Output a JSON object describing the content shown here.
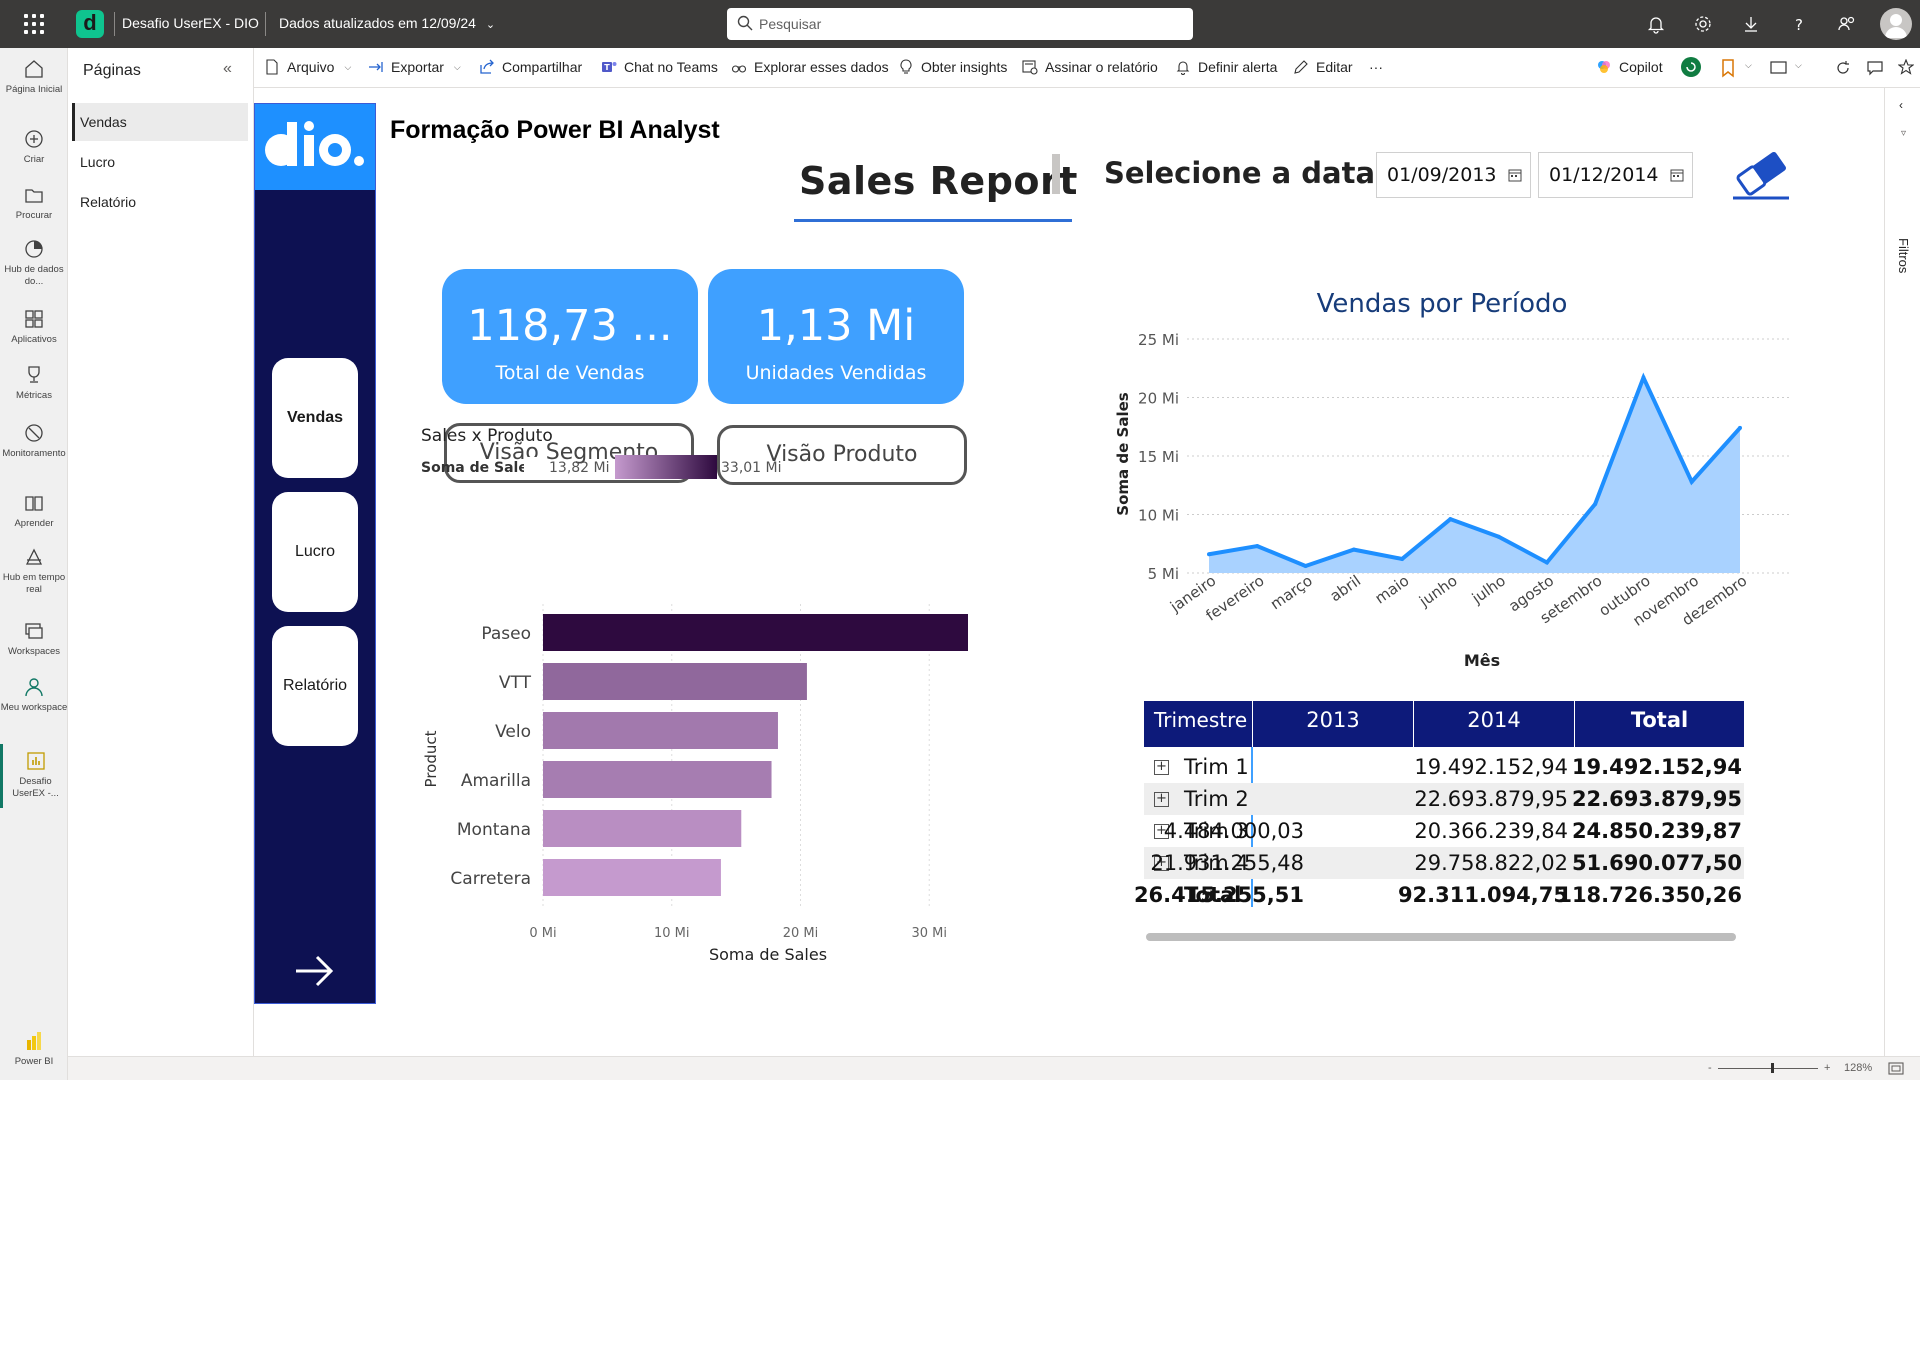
{
  "topbar": {
    "app_title": "Desafio UserEX - DIO",
    "updated": "Dados atualizados em 12/09/24",
    "search_placeholder": "Pesquisar"
  },
  "rail": {
    "items": [
      {
        "label": "Página Inicial",
        "icon": "home-icon"
      },
      {
        "label": "Criar",
        "icon": "plus-circle-icon"
      },
      {
        "label": "Procurar",
        "icon": "folder-icon"
      },
      {
        "label": "Hub de dados do...",
        "icon": "data-hub-icon"
      },
      {
        "label": "Aplicativos",
        "icon": "apps-icon"
      },
      {
        "label": "Métricas",
        "icon": "trophy-icon"
      },
      {
        "label": "Monitoramento",
        "icon": "monitor-icon"
      },
      {
        "label": "Aprender",
        "icon": "book-icon"
      },
      {
        "label": "Hub em tempo real",
        "icon": "realtime-hub-icon"
      },
      {
        "label": "Workspaces",
        "icon": "workspaces-icon"
      },
      {
        "label": "Meu workspace",
        "icon": "person-icon"
      },
      {
        "label": "Desafio UserEX -...",
        "icon": "report-icon"
      }
    ],
    "footer_label": "Power BI"
  },
  "pages": {
    "title": "Páginas",
    "items": [
      "Vendas",
      "Lucro",
      "Relatório"
    ],
    "active": "Vendas"
  },
  "toolbar": {
    "file": "Arquivo",
    "export": "Exportar",
    "share": "Compartilhar",
    "teams": "Chat no Teams",
    "explore": "Explorar esses dados",
    "insights": "Obter insights",
    "subscribe": "Assinar o relatório",
    "alert": "Definir alerta",
    "edit": "Editar",
    "more": "···",
    "copilot": "Copilot"
  },
  "filters_label": "Filtros",
  "status": {
    "zoom": "128%",
    "minus": "-",
    "plus": "+"
  },
  "report": {
    "title": "Formação Power BI Analyst",
    "heading": "Sales Report",
    "select_date_label": "Selecione a data",
    "date_start": "01/09/2013",
    "date_end": "01/12/2014",
    "nav_buttons": [
      "Vendas",
      "Lucro",
      "Relatório"
    ],
    "kpis": [
      {
        "value": "118,73 ...",
        "label": "Total de Vendas"
      },
      {
        "value": "1,13 Mi",
        "label": "Unidades Vendidas"
      }
    ],
    "view_buttons": [
      "Visão Segmento",
      "Visão Produto"
    ]
  },
  "colors": {
    "navy": "#0d1152",
    "kpi_blue": "#3fa0ff",
    "matrix_header": "#0d1a7a",
    "line_blue": "#1e8fff",
    "area_fill": "#a9d2ff",
    "bar_dark": "#2e0a3f",
    "bar_light": "#c59ace"
  },
  "chart_data": [
    {
      "type": "bar",
      "orientation": "horizontal",
      "title": "Sales x Produto",
      "legend_title": "Soma de  Sales",
      "legend_min": "13,82 Mi",
      "legend_max": "33,01 Mi",
      "ylabel": "Product",
      "xlabel": "Soma de Sales",
      "categories": [
        "Paseo",
        "VTT",
        "Velo",
        "Amarilla",
        "Montana",
        "Carretera"
      ],
      "values": [
        33.01,
        20.5,
        18.25,
        17.75,
        15.4,
        13.82
      ],
      "unit": "Mi",
      "xlim": [
        0,
        33.01
      ],
      "xticks": [
        "0 Mi",
        "10 Mi",
        "20 Mi",
        "30 Mi"
      ],
      "grid": true
    },
    {
      "type": "area",
      "title": "Vendas por Período",
      "xlabel": "Mês",
      "ylabel": "Soma de Sales",
      "categories": [
        "janeiro",
        "fevereiro",
        "março",
        "abril",
        "maio",
        "junho",
        "julho",
        "agosto",
        "setembro",
        "outubro",
        "novembro",
        "dezembro"
      ],
      "values": [
        6.6,
        7.3,
        5.6,
        7.0,
        6.2,
        9.6,
        8.1,
        5.9,
        10.9,
        21.7,
        12.8,
        17.4
      ],
      "unit": "Mi",
      "ylim": [
        5,
        25
      ],
      "yticks": [
        "5 Mi",
        "10 Mi",
        "15 Mi",
        "20 Mi",
        "25 Mi"
      ],
      "grid": true
    },
    {
      "type": "table",
      "columns": [
        "Trimestre",
        "2013",
        "2014",
        "Total"
      ],
      "rows": [
        [
          "Trim 1",
          "",
          "19.492.152,94",
          "19.492.152,94"
        ],
        [
          "Trim 2",
          "",
          "22.693.879,95",
          "22.693.879,95"
        ],
        [
          "Trim 3",
          "4.484.000,03",
          "20.366.239,84",
          "24.850.239,87"
        ],
        [
          "Trim 4",
          "21.931.255,48",
          "29.758.822,02",
          "51.690.077,50"
        ]
      ],
      "total_row": [
        "Total",
        "26.415.255,51",
        "92.311.094,75",
        "118.726.350,26"
      ]
    }
  ]
}
